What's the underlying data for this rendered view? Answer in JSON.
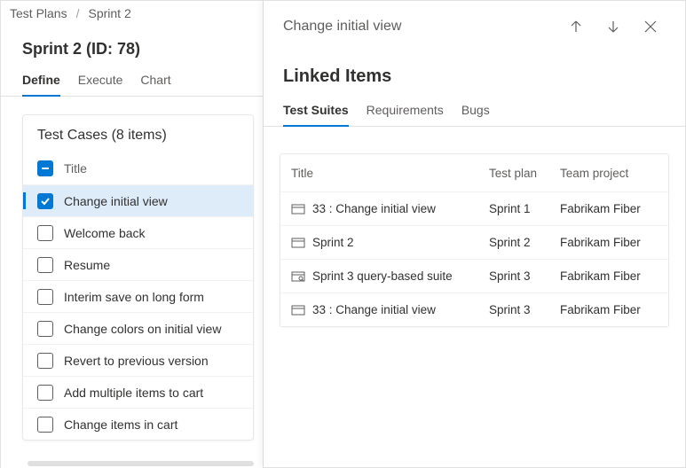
{
  "breadcrumb": {
    "root": "Test Plans",
    "current": "Sprint 2"
  },
  "page_title": "Sprint 2 (ID: 78)",
  "main_tabs": [
    "Define",
    "Execute",
    "Chart"
  ],
  "main_tabs_active": 0,
  "test_cases": {
    "header": "Test Cases (8 items)",
    "column_label": "Title",
    "items": [
      {
        "title": "Change initial view",
        "checked": true
      },
      {
        "title": "Welcome back",
        "checked": false
      },
      {
        "title": "Resume",
        "checked": false
      },
      {
        "title": "Interim save on long form",
        "checked": false
      },
      {
        "title": "Change colors on initial view",
        "checked": false
      },
      {
        "title": "Revert to previous version",
        "checked": false
      },
      {
        "title": "Add multiple items to cart",
        "checked": false
      },
      {
        "title": "Change items in cart",
        "checked": false
      }
    ]
  },
  "side_panel": {
    "title": "Change initial view",
    "section": "Linked Items",
    "tabs": [
      "Test Suites",
      "Requirements",
      "Bugs"
    ],
    "active_tab": 0,
    "columns": {
      "title": "Title",
      "plan": "Test plan",
      "project": "Team project"
    },
    "rows": [
      {
        "icon": "static",
        "title": "33 : Change initial view",
        "plan": "Sprint 1",
        "project": "Fabrikam Fiber"
      },
      {
        "icon": "static",
        "title": "Sprint 2",
        "plan": "Sprint 2",
        "project": "Fabrikam Fiber"
      },
      {
        "icon": "query",
        "title": "Sprint 3 query-based suite",
        "plan": "Sprint 3",
        "project": "Fabrikam Fiber"
      },
      {
        "icon": "static",
        "title": "33 : Change initial view",
        "plan": "Sprint 3",
        "project": "Fabrikam Fiber"
      }
    ]
  }
}
